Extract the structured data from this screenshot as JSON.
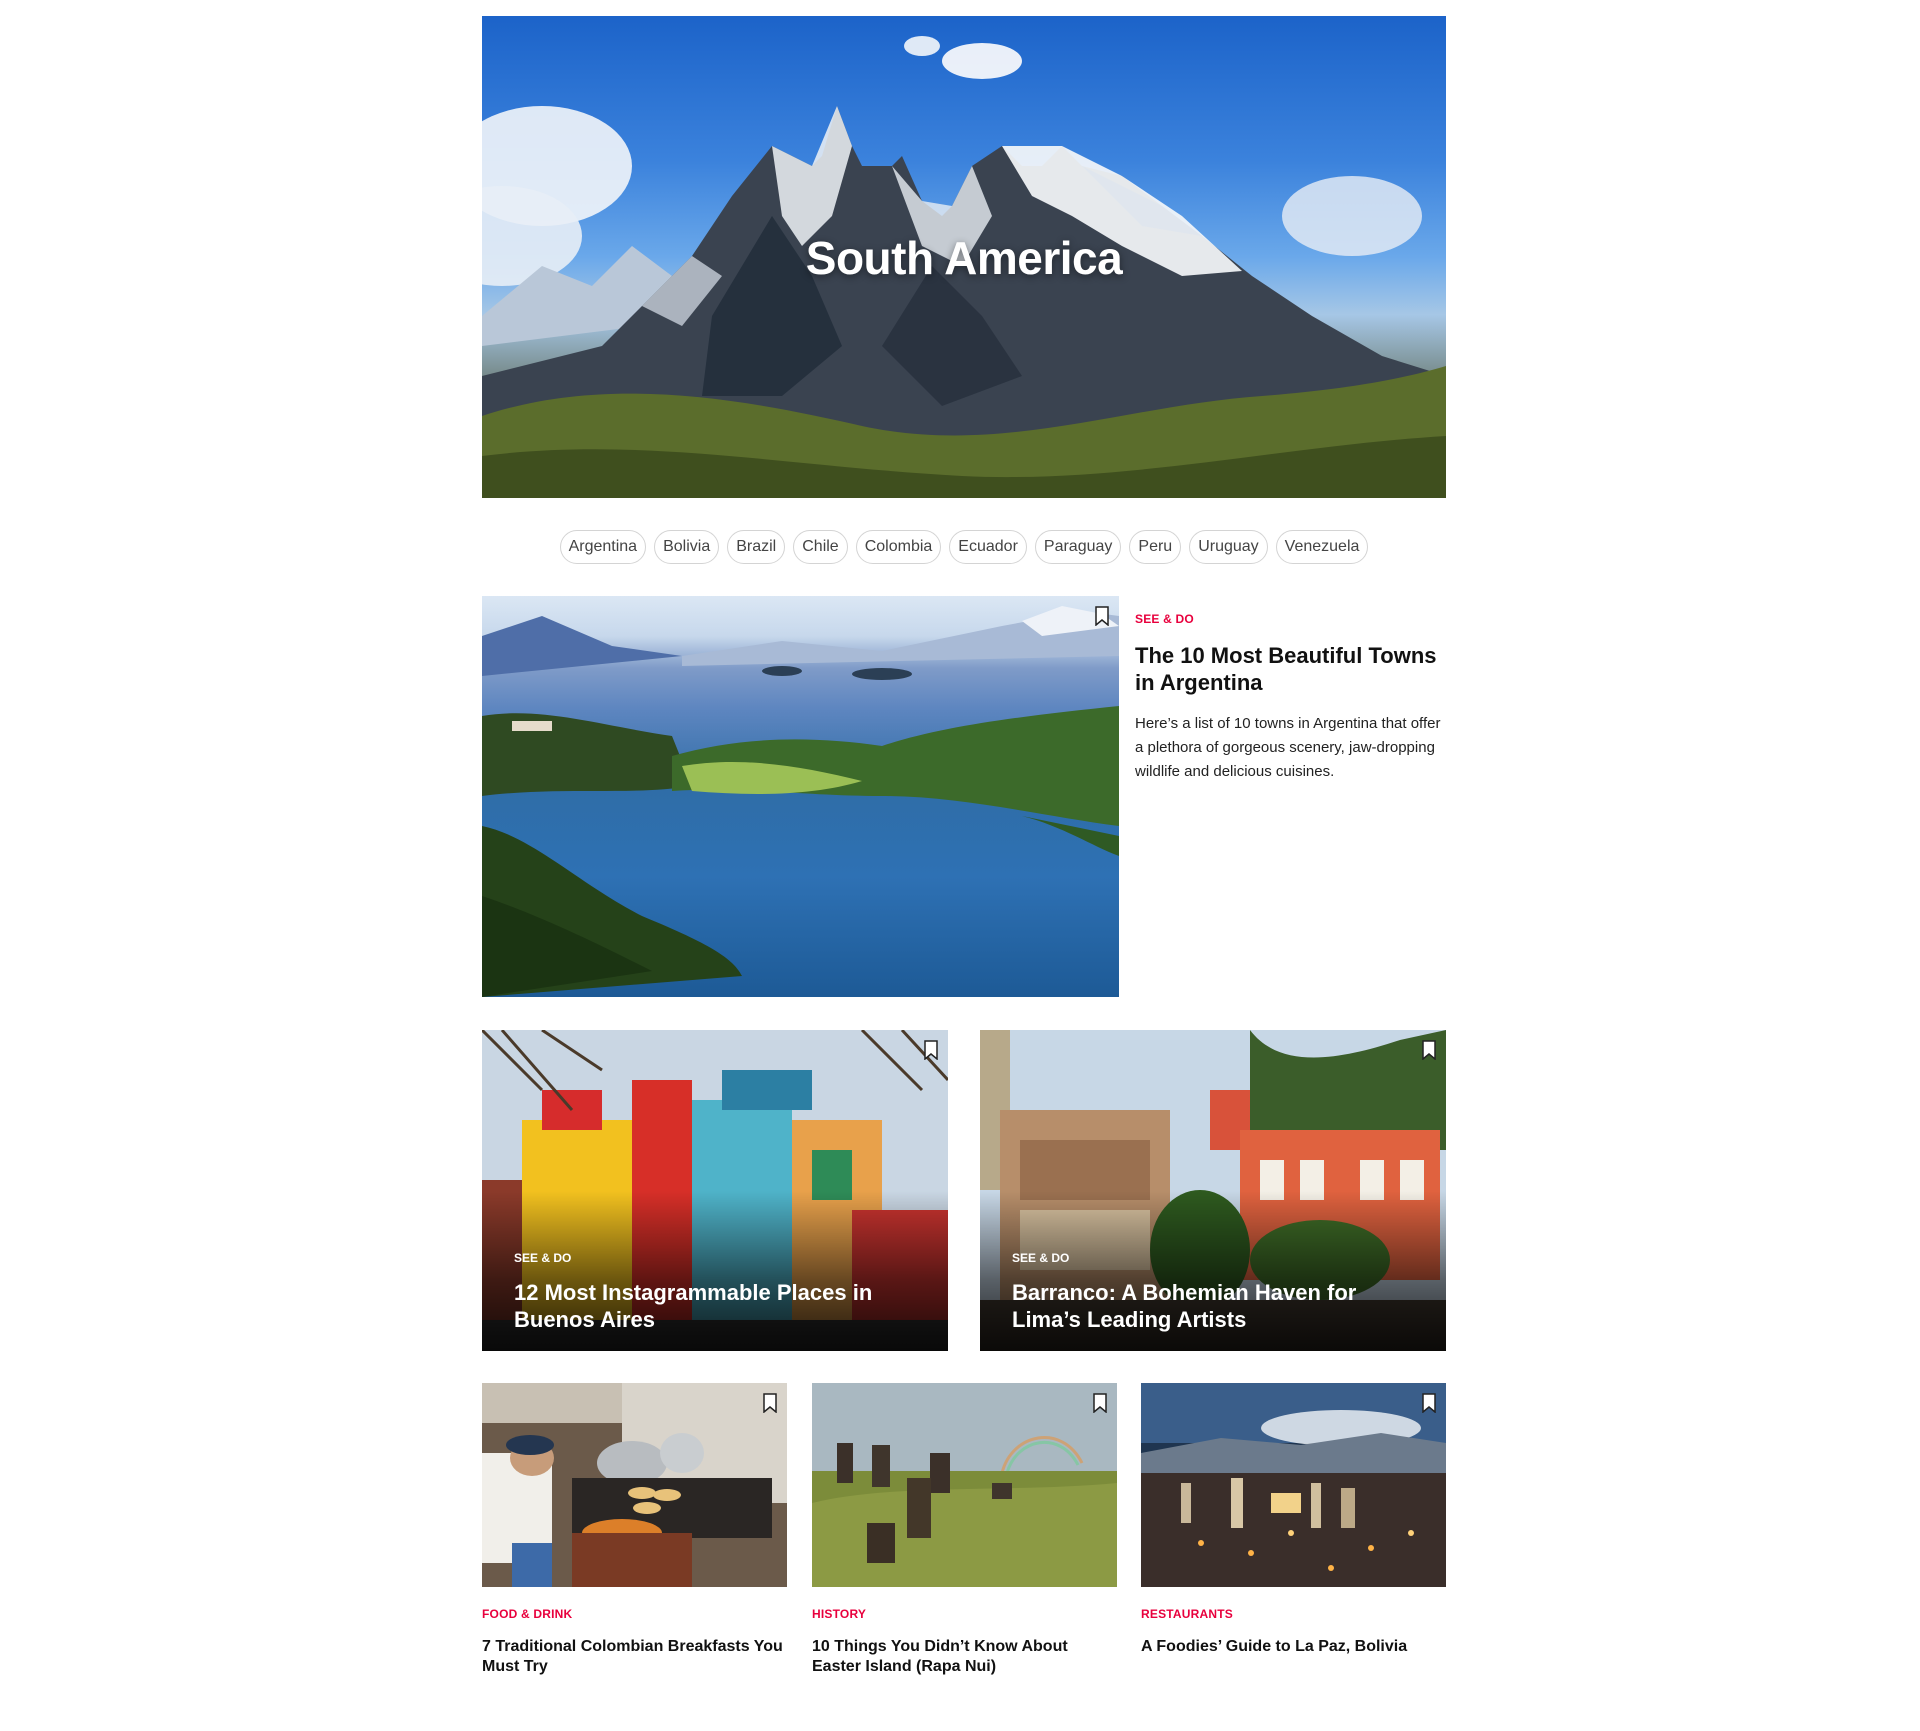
{
  "hero": {
    "title": "South America"
  },
  "countries": [
    "Argentina",
    "Bolivia",
    "Brazil",
    "Chile",
    "Colombia",
    "Ecuador",
    "Paraguay",
    "Peru",
    "Uruguay",
    "Venezuela"
  ],
  "featured": {
    "category": "SEE & DO",
    "title": "The 10 Most Beautiful Towns in Argentina",
    "excerpt": "Here’s a list of 10 towns in Argentina that offer a plethora of gorgeous scenery, jaw-dropping wildlife and delicious cuisines."
  },
  "overlay_cards": [
    {
      "category": "SEE & DO",
      "title": "12 Most Instagrammable Places in Buenos Aires"
    },
    {
      "category": "SEE & DO",
      "title": "Barranco: A Bohemian Haven for Lima’s Leading Artists"
    }
  ],
  "small_cards": [
    {
      "category": "FOOD & DRINK",
      "title": "7 Traditional Colombian Breakfasts You Must Try"
    },
    {
      "category": "HISTORY",
      "title": "10 Things You Didn’t Know About Easter Island (Rapa Nui)"
    },
    {
      "category": "RESTAURANTS",
      "title": "A Foodies’ Guide to La Paz, Bolivia"
    }
  ],
  "colors": {
    "accent": "#e8003d",
    "pill_border": "#d4d4d4"
  },
  "icons": {
    "bookmark": "bookmark-icon"
  }
}
